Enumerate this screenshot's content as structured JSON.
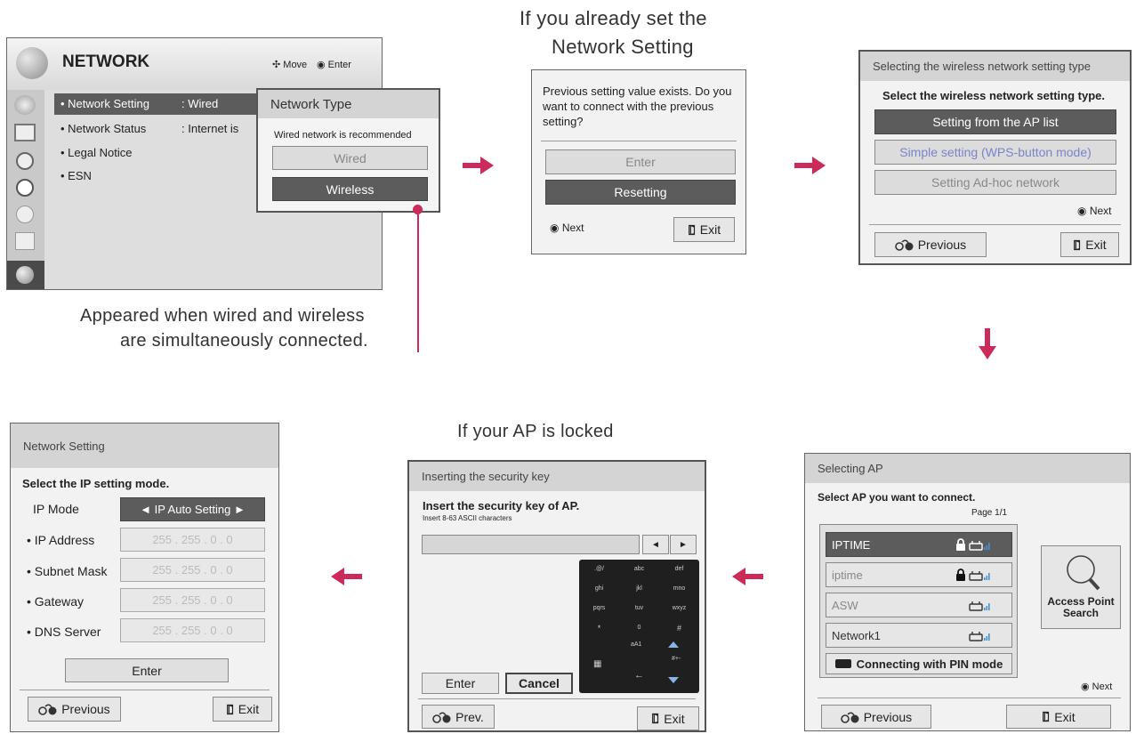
{
  "network_menu": {
    "title": "NETWORK",
    "hint_move": "Move",
    "hint_enter": "Enter",
    "items": [
      {
        "label": "• Network Setting",
        "value": ": Wired"
      },
      {
        "label": "• Network Status",
        "value": ": Internet is"
      },
      {
        "label": "• Legal Notice",
        "value": ""
      },
      {
        "label": "• ESN",
        "value": ""
      }
    ],
    "side_icons": [
      "picture-icon",
      "screen-icon",
      "audio-icon",
      "time-icon",
      "lock-icon",
      "option-icon",
      "network-icon"
    ]
  },
  "network_type_popup": {
    "title": "Network Type",
    "note": "Wired network is recommended",
    "wired": "Wired",
    "wireless": "Wireless"
  },
  "caption_simultaneous": {
    "line1": "Appeared when wired and wireless",
    "line2": "are simultaneously connected."
  },
  "caption_already_set": {
    "line1": "If you already set the",
    "line2": "Network Setting"
  },
  "previous_setting_dialog": {
    "message": "Previous setting value exists. Do you want to connect with the previous setting?",
    "enter": "Enter",
    "resetting": "Resetting",
    "next": "Next",
    "exit": "Exit"
  },
  "wireless_type_dialog": {
    "title": "Selecting the wireless network setting type",
    "heading": "Select the wireless network setting type.",
    "options": [
      "Setting from the AP list",
      "Simple setting (WPS-button mode)",
      "Setting Ad-hoc network"
    ],
    "next": "Next",
    "previous": "Previous",
    "exit": "Exit"
  },
  "selecting_ap_dialog": {
    "title": "Selecting AP",
    "heading": "Select AP you want to connect.",
    "page": "Page 1/1",
    "aps": [
      {
        "name": "IPTIME",
        "locked": true
      },
      {
        "name": "iptime",
        "locked": true
      },
      {
        "name": "ASW",
        "locked": false
      },
      {
        "name": "Network1",
        "locked": false
      }
    ],
    "pin_button": "Connecting with PIN mode",
    "search_button": "Access Point Search",
    "next": "Next",
    "previous": "Previous",
    "exit": "Exit"
  },
  "caption_locked": "If your AP is locked",
  "security_key_dialog": {
    "title": "Inserting the security key",
    "heading": "Insert the security key of AP.",
    "sub": "Insert 8-63 ASCII characters",
    "keypad": [
      ".@/",
      "abc",
      "def",
      "ghi",
      "jkl",
      "mno",
      "pqrs",
      "tuv",
      "wxyz",
      "*",
      "0",
      "#"
    ],
    "key_a1": "aA1",
    "key_del": "#+-",
    "enter": "Enter",
    "cancel": "Cancel",
    "prev": "Prev.",
    "exit": "Exit"
  },
  "network_setting_dialog": {
    "title": "Network Setting",
    "heading": "Select the IP setting mode.",
    "ip_mode_label": "IP Mode",
    "ip_mode_value": "◄ IP Auto Setting ►",
    "rows": [
      {
        "label": "• IP Address",
        "value": "255 . 255 . 0 . 0"
      },
      {
        "label": "• Subnet Mask",
        "value": "255 . 255 . 0 . 0"
      },
      {
        "label": "• Gateway",
        "value": "255 . 255 . 0 . 0"
      },
      {
        "label": "• DNS Server",
        "value": "255 . 255 . 0 . 0"
      }
    ],
    "enter": "Enter",
    "previous": "Previous",
    "exit": "Exit"
  },
  "colors": {
    "arrow": "#cc2a5a",
    "selected": "#5c5c5c",
    "panel": "#f2f2f2",
    "titlebar": "#d4d4d4"
  }
}
